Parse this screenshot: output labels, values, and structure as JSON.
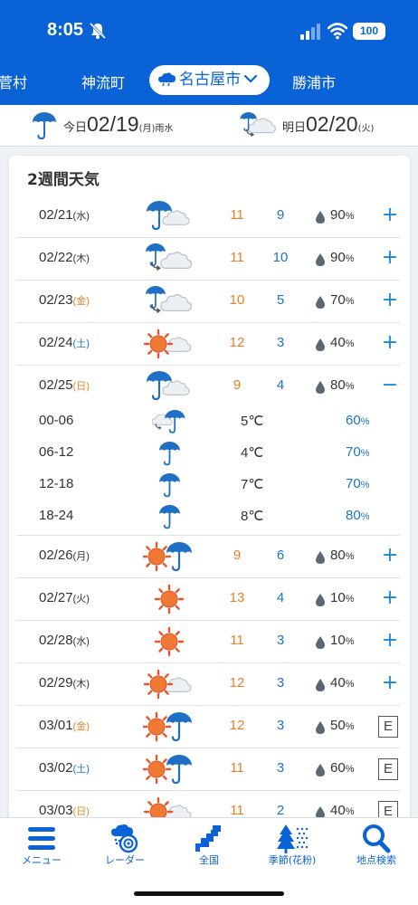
{
  "status_bar": {
    "time": "8:05",
    "battery": "100"
  },
  "city_tabs": [
    {
      "label": "菅村",
      "active": false
    },
    {
      "label": "神流町",
      "active": false
    },
    {
      "label": "名古屋市",
      "active": true
    },
    {
      "label": "勝浦市",
      "active": false
    }
  ],
  "date_bar": {
    "today_label": "今日",
    "today_date": "02/19",
    "today_weekday": "(月)",
    "today_note": "雨水",
    "tomorrow_label": "明日",
    "tomorrow_date": "02/20",
    "tomorrow_weekday": "(火)"
  },
  "card": {
    "title": "2週間天気",
    "rows": [
      {
        "date": "02/21",
        "weekday": "(水)",
        "weekday_color": "#333333",
        "icon": "rain-cloud-icon",
        "high": "11",
        "low": "9",
        "pop": "90",
        "pct": "%",
        "action": "+"
      },
      {
        "date": "02/22",
        "weekday": "(木)",
        "weekday_color": "#333333",
        "icon": "rain-then-cloud-icon",
        "high": "11",
        "low": "10",
        "pop": "90",
        "pct": "%",
        "action": "+"
      },
      {
        "date": "02/23",
        "weekday": "(金)",
        "weekday_color": "#e8862a",
        "icon": "rain-then-cloud-icon",
        "high": "10",
        "low": "5",
        "pop": "70",
        "pct": "%",
        "action": "+"
      },
      {
        "date": "02/24",
        "weekday": "(土)",
        "weekday_color": "#1c73c7",
        "icon": "sun-cloud-icon",
        "high": "12",
        "low": "3",
        "pop": "40",
        "pct": "%",
        "action": "+"
      },
      {
        "date": "02/25",
        "weekday": "(日)",
        "weekday_color": "#e8862a",
        "icon": "rain-cloud-icon",
        "high": "9",
        "low": "4",
        "pop": "80",
        "pct": "%",
        "action": "−",
        "details": [
          {
            "slot": "00-06",
            "icon": "cloud-rain-icon",
            "temp": "5℃",
            "pop": "60",
            "pct": "%"
          },
          {
            "slot": "06-12",
            "icon": "umbrella-icon",
            "temp": "4℃",
            "pop": "70",
            "pct": "%"
          },
          {
            "slot": "12-18",
            "icon": "umbrella-icon",
            "temp": "7℃",
            "pop": "70",
            "pct": "%"
          },
          {
            "slot": "18-24",
            "icon": "umbrella-icon",
            "temp": "8℃",
            "pop": "80",
            "pct": "%"
          }
        ]
      },
      {
        "date": "02/26",
        "weekday": "(月)",
        "weekday_color": "#333333",
        "icon": "sun-rain-icon",
        "high": "9",
        "low": "6",
        "pop": "80",
        "pct": "%",
        "action": "+"
      },
      {
        "date": "02/27",
        "weekday": "(火)",
        "weekday_color": "#333333",
        "icon": "sun-icon",
        "high": "13",
        "low": "4",
        "pop": "10",
        "pct": "%",
        "action": "+"
      },
      {
        "date": "02/28",
        "weekday": "(水)",
        "weekday_color": "#333333",
        "icon": "sun-icon",
        "high": "11",
        "low": "3",
        "pop": "10",
        "pct": "%",
        "action": "+"
      },
      {
        "date": "02/29",
        "weekday": "(木)",
        "weekday_color": "#333333",
        "icon": "sun-cloud-icon",
        "high": "12",
        "low": "3",
        "pop": "40",
        "pct": "%",
        "action": "+"
      },
      {
        "date": "03/01",
        "weekday": "(金)",
        "weekday_color": "#e8862a",
        "icon": "sun-rain-icon",
        "high": "12",
        "low": "3",
        "pop": "50",
        "pct": "%",
        "action": "E"
      },
      {
        "date": "03/02",
        "weekday": "(土)",
        "weekday_color": "#1c73c7",
        "icon": "sun-rain-icon",
        "high": "11",
        "low": "3",
        "pop": "60",
        "pct": "%",
        "action": "E"
      },
      {
        "date": "03/03",
        "weekday": "(日)",
        "weekday_color": "#e8862a",
        "icon": "sun-cloud-icon",
        "high": "11",
        "low": "2",
        "pop": "40",
        "pct": "%",
        "action": "E"
      }
    ]
  },
  "bottom_nav": [
    {
      "label": "メニュー",
      "icon": "menu-icon"
    },
    {
      "label": "レーダー",
      "icon": "radar-icon"
    },
    {
      "label": "全国",
      "icon": "japan-map-icon"
    },
    {
      "label": "季節(花粉)",
      "icon": "pollen-tree-icon"
    },
    {
      "label": "地点検索",
      "icon": "search-icon"
    }
  ],
  "colors": {
    "brand": "#0a63d6",
    "high_temp": "#ee7d22",
    "low_temp": "#1c73c7",
    "toggle": "#1a88d8"
  }
}
